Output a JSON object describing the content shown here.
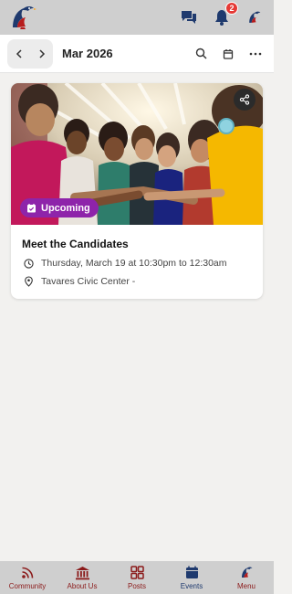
{
  "header": {
    "notification_count": "2",
    "icons": [
      "logo",
      "chat-icon",
      "bell-icon",
      "profile-logo"
    ]
  },
  "toolbar": {
    "month_label": "Mar 2026"
  },
  "event": {
    "status_label": "Upcoming",
    "title": "Meet the Candidates",
    "datetime": "Thursday, March 19 at 10:30pm to 12:30am",
    "location": "Tavares Civic Center -"
  },
  "bottom_nav": {
    "items": [
      {
        "label": "Community",
        "icon": "rss-icon"
      },
      {
        "label": "About Us",
        "icon": "bank-icon"
      },
      {
        "label": "Posts",
        "icon": "grid-icon"
      },
      {
        "label": "Events",
        "icon": "calendar-icon"
      },
      {
        "label": "Menu",
        "icon": "logo"
      }
    ]
  },
  "colors": {
    "accent": "#8b1a1a",
    "tag": "#8e24aa",
    "navy": "#1f3a6e",
    "badge": "#e53935"
  }
}
